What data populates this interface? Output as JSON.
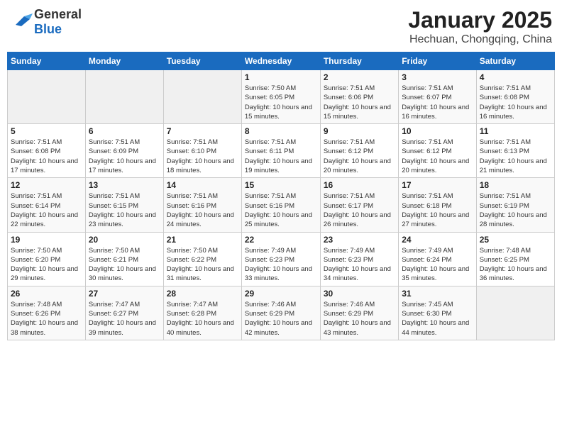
{
  "logo": {
    "general": "General",
    "blue": "Blue"
  },
  "title": "January 2025",
  "subtitle": "Hechuan, Chongqing, China",
  "days_of_week": [
    "Sunday",
    "Monday",
    "Tuesday",
    "Wednesday",
    "Thursday",
    "Friday",
    "Saturday"
  ],
  "weeks": [
    [
      {
        "day": "",
        "info": ""
      },
      {
        "day": "",
        "info": ""
      },
      {
        "day": "",
        "info": ""
      },
      {
        "day": "1",
        "info": "Sunrise: 7:50 AM\nSunset: 6:05 PM\nDaylight: 10 hours and 15 minutes."
      },
      {
        "day": "2",
        "info": "Sunrise: 7:51 AM\nSunset: 6:06 PM\nDaylight: 10 hours and 15 minutes."
      },
      {
        "day": "3",
        "info": "Sunrise: 7:51 AM\nSunset: 6:07 PM\nDaylight: 10 hours and 16 minutes."
      },
      {
        "day": "4",
        "info": "Sunrise: 7:51 AM\nSunset: 6:08 PM\nDaylight: 10 hours and 16 minutes."
      }
    ],
    [
      {
        "day": "5",
        "info": "Sunrise: 7:51 AM\nSunset: 6:08 PM\nDaylight: 10 hours and 17 minutes."
      },
      {
        "day": "6",
        "info": "Sunrise: 7:51 AM\nSunset: 6:09 PM\nDaylight: 10 hours and 17 minutes."
      },
      {
        "day": "7",
        "info": "Sunrise: 7:51 AM\nSunset: 6:10 PM\nDaylight: 10 hours and 18 minutes."
      },
      {
        "day": "8",
        "info": "Sunrise: 7:51 AM\nSunset: 6:11 PM\nDaylight: 10 hours and 19 minutes."
      },
      {
        "day": "9",
        "info": "Sunrise: 7:51 AM\nSunset: 6:12 PM\nDaylight: 10 hours and 20 minutes."
      },
      {
        "day": "10",
        "info": "Sunrise: 7:51 AM\nSunset: 6:12 PM\nDaylight: 10 hours and 20 minutes."
      },
      {
        "day": "11",
        "info": "Sunrise: 7:51 AM\nSunset: 6:13 PM\nDaylight: 10 hours and 21 minutes."
      }
    ],
    [
      {
        "day": "12",
        "info": "Sunrise: 7:51 AM\nSunset: 6:14 PM\nDaylight: 10 hours and 22 minutes."
      },
      {
        "day": "13",
        "info": "Sunrise: 7:51 AM\nSunset: 6:15 PM\nDaylight: 10 hours and 23 minutes."
      },
      {
        "day": "14",
        "info": "Sunrise: 7:51 AM\nSunset: 6:16 PM\nDaylight: 10 hours and 24 minutes."
      },
      {
        "day": "15",
        "info": "Sunrise: 7:51 AM\nSunset: 6:16 PM\nDaylight: 10 hours and 25 minutes."
      },
      {
        "day": "16",
        "info": "Sunrise: 7:51 AM\nSunset: 6:17 PM\nDaylight: 10 hours and 26 minutes."
      },
      {
        "day": "17",
        "info": "Sunrise: 7:51 AM\nSunset: 6:18 PM\nDaylight: 10 hours and 27 minutes."
      },
      {
        "day": "18",
        "info": "Sunrise: 7:51 AM\nSunset: 6:19 PM\nDaylight: 10 hours and 28 minutes."
      }
    ],
    [
      {
        "day": "19",
        "info": "Sunrise: 7:50 AM\nSunset: 6:20 PM\nDaylight: 10 hours and 29 minutes."
      },
      {
        "day": "20",
        "info": "Sunrise: 7:50 AM\nSunset: 6:21 PM\nDaylight: 10 hours and 30 minutes."
      },
      {
        "day": "21",
        "info": "Sunrise: 7:50 AM\nSunset: 6:22 PM\nDaylight: 10 hours and 31 minutes."
      },
      {
        "day": "22",
        "info": "Sunrise: 7:49 AM\nSunset: 6:23 PM\nDaylight: 10 hours and 33 minutes."
      },
      {
        "day": "23",
        "info": "Sunrise: 7:49 AM\nSunset: 6:23 PM\nDaylight: 10 hours and 34 minutes."
      },
      {
        "day": "24",
        "info": "Sunrise: 7:49 AM\nSunset: 6:24 PM\nDaylight: 10 hours and 35 minutes."
      },
      {
        "day": "25",
        "info": "Sunrise: 7:48 AM\nSunset: 6:25 PM\nDaylight: 10 hours and 36 minutes."
      }
    ],
    [
      {
        "day": "26",
        "info": "Sunrise: 7:48 AM\nSunset: 6:26 PM\nDaylight: 10 hours and 38 minutes."
      },
      {
        "day": "27",
        "info": "Sunrise: 7:47 AM\nSunset: 6:27 PM\nDaylight: 10 hours and 39 minutes."
      },
      {
        "day": "28",
        "info": "Sunrise: 7:47 AM\nSunset: 6:28 PM\nDaylight: 10 hours and 40 minutes."
      },
      {
        "day": "29",
        "info": "Sunrise: 7:46 AM\nSunset: 6:29 PM\nDaylight: 10 hours and 42 minutes."
      },
      {
        "day": "30",
        "info": "Sunrise: 7:46 AM\nSunset: 6:29 PM\nDaylight: 10 hours and 43 minutes."
      },
      {
        "day": "31",
        "info": "Sunrise: 7:45 AM\nSunset: 6:30 PM\nDaylight: 10 hours and 44 minutes."
      },
      {
        "day": "",
        "info": ""
      }
    ]
  ]
}
